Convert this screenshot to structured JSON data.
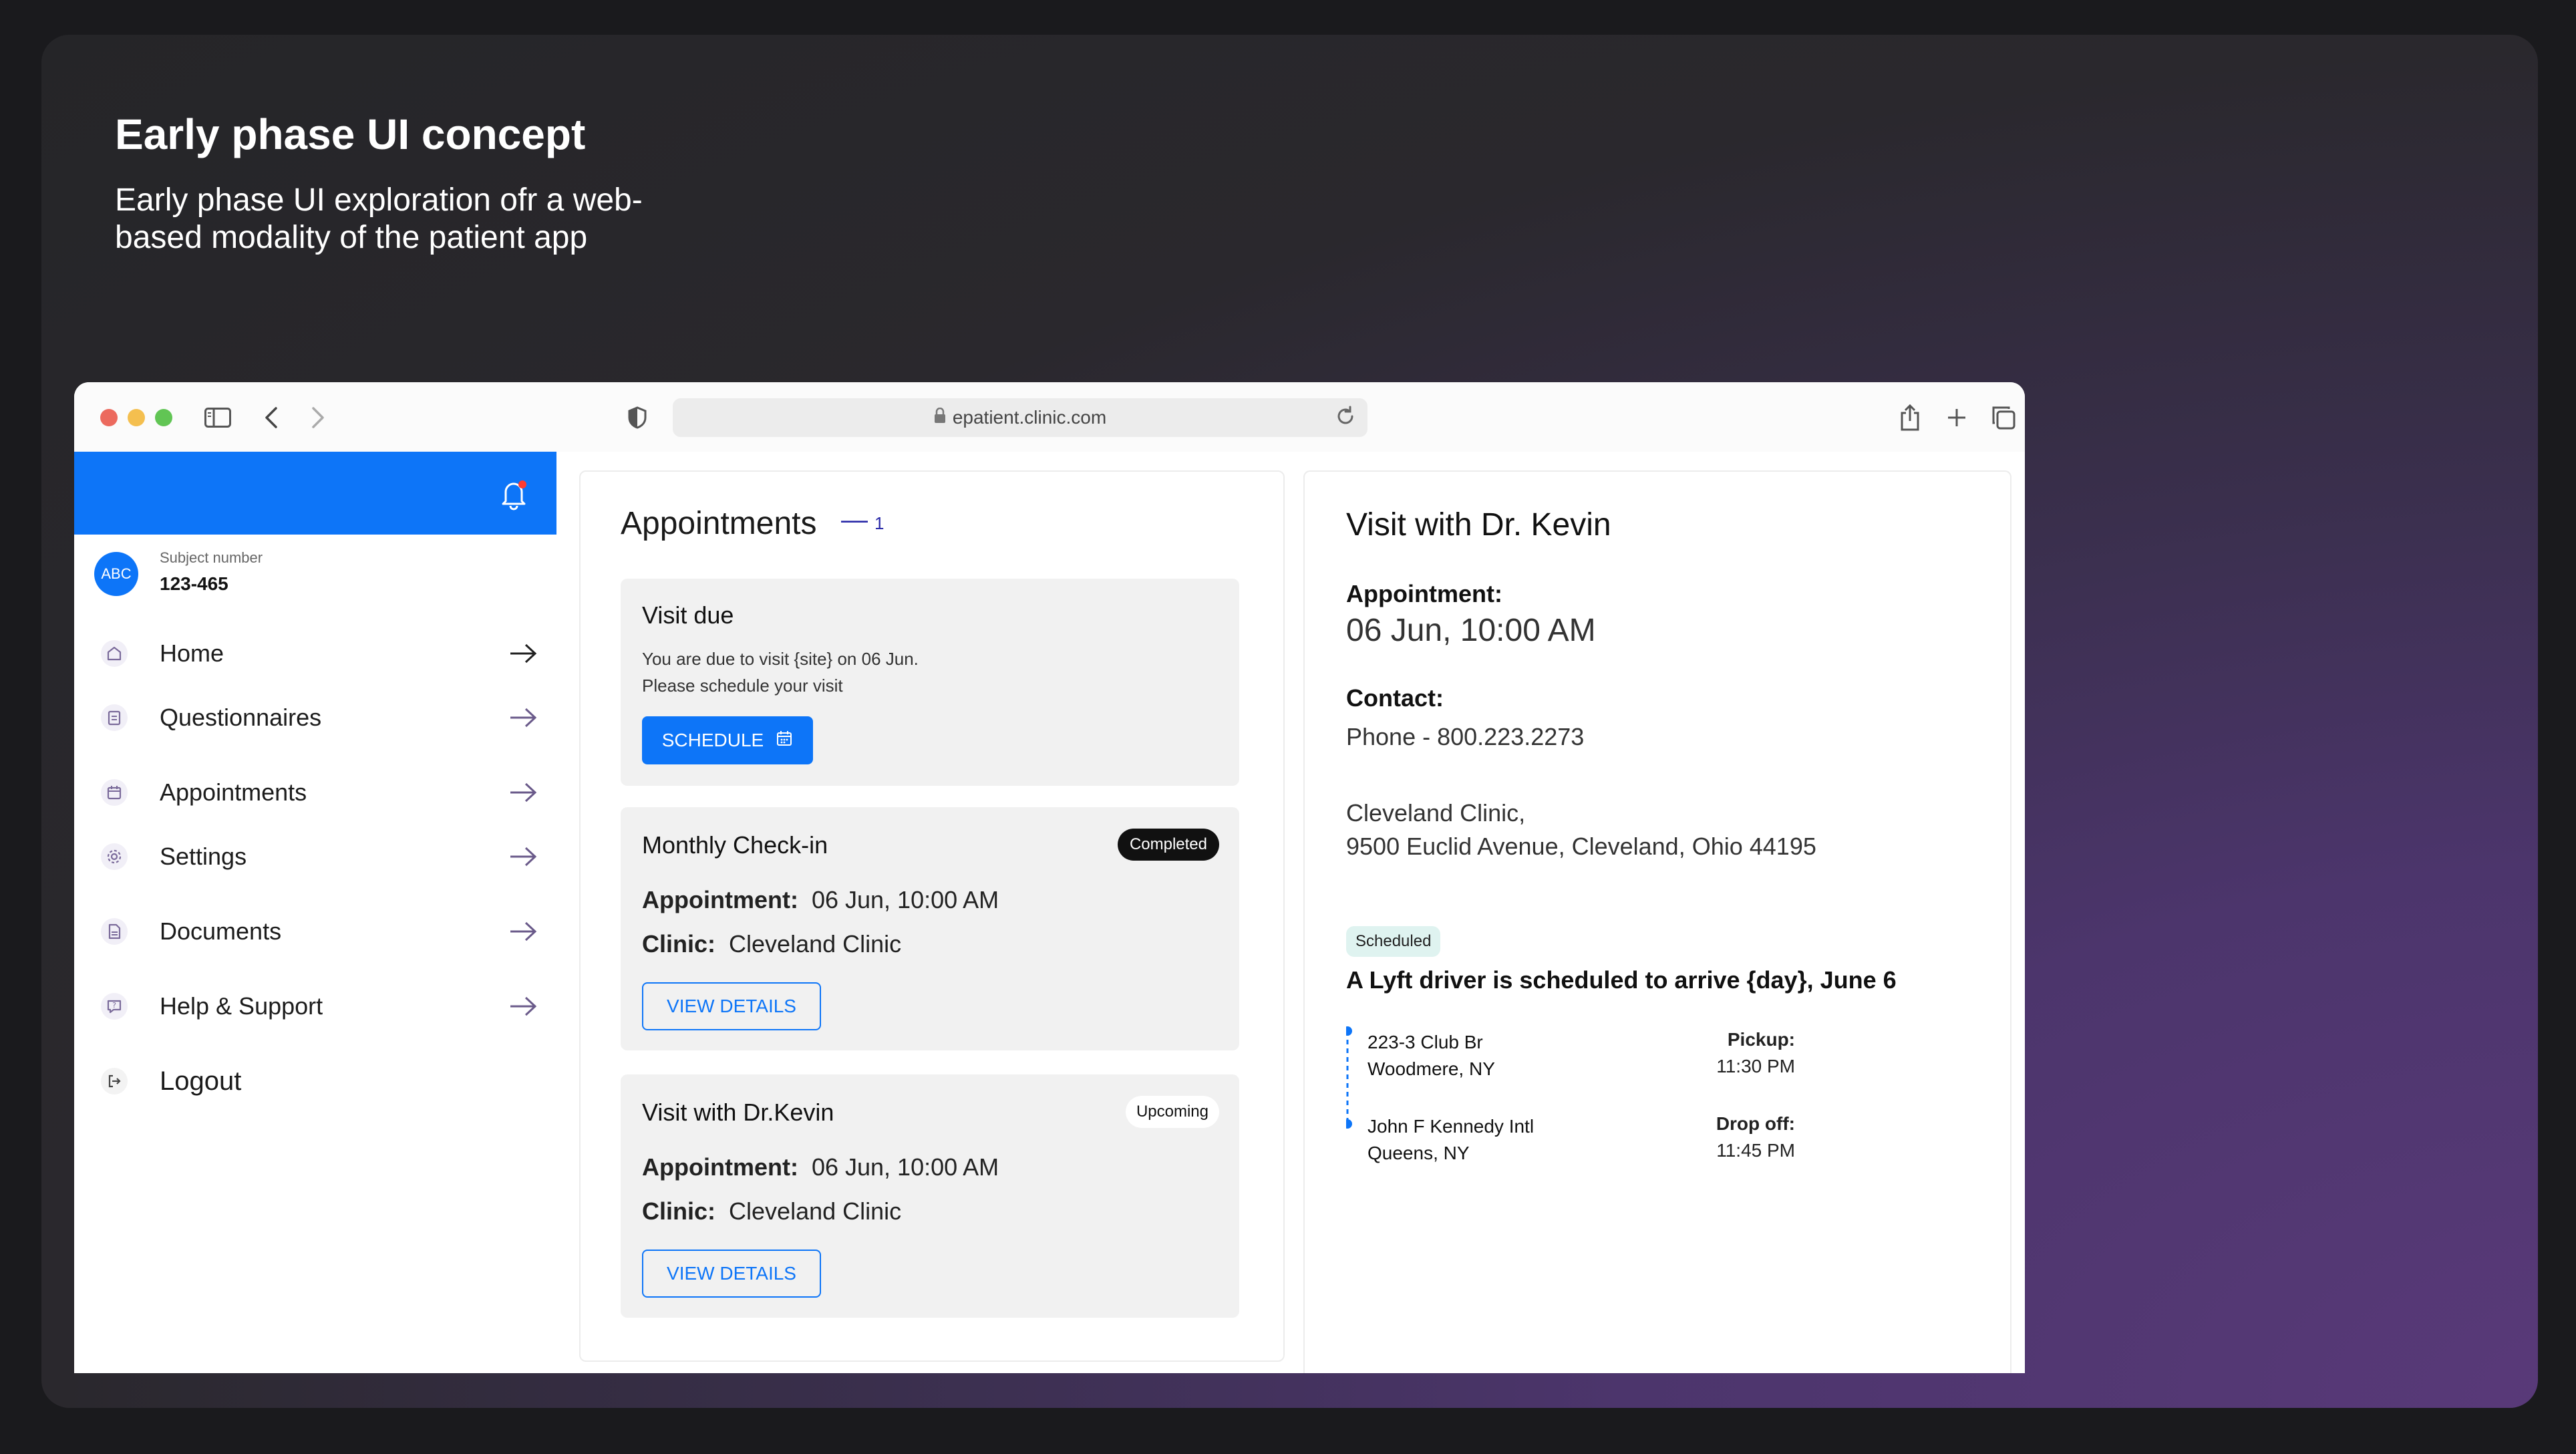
{
  "hero": {
    "title": "Early phase UI concept",
    "subtitle": "Early phase UI exploration ofr a web-based modality of the patient app"
  },
  "browser": {
    "url": "epatient.clinic.com"
  },
  "sidebar": {
    "subject_label": "Subject number",
    "subject_number": "123-465",
    "avatar_text": "ABC",
    "items": [
      {
        "label": "Home",
        "icon": "home-icon"
      },
      {
        "label": "Questionnaires",
        "icon": "clipboard-icon"
      },
      {
        "label": "Appointments",
        "icon": "calendar-icon"
      },
      {
        "label": "Settings",
        "icon": "gear-icon"
      },
      {
        "label": "Documents",
        "icon": "document-icon"
      },
      {
        "label": "Help & Support",
        "icon": "help-chat-icon"
      },
      {
        "label": "Logout",
        "icon": "logout-icon"
      }
    ]
  },
  "appointments": {
    "title": "Appointments",
    "dash": "—",
    "count": "1",
    "visit_due": {
      "title": "Visit due",
      "line1": "You are due to visit {site} on 06 Jun.",
      "line2": "Please schedule your visit",
      "button": "SCHEDULE"
    },
    "cards": [
      {
        "title": "Monthly Check-in",
        "badge": "Completed",
        "appt_label": "Appointment:",
        "appt_value": "06 Jun, 10:00 AM",
        "clinic_label": "Clinic:",
        "clinic_value": "Cleveland Clinic",
        "button": "VIEW DETAILS"
      },
      {
        "title": "Visit with Dr.Kevin",
        "badge": "Upcoming",
        "appt_label": "Appointment:",
        "appt_value": "06 Jun, 10:00 AM",
        "clinic_label": "Clinic:",
        "clinic_value": "Cleveland Clinic",
        "button": "VIEW DETAILS"
      }
    ]
  },
  "visit": {
    "title": "Visit with Dr. Kevin",
    "appt_label": "Appointment:",
    "appt_value": "06 Jun, 10:00 AM",
    "contact_label": "Contact:",
    "phone": "Phone - 800.223.2273",
    "address_line1": "Cleveland Clinic,",
    "address_line2": "9500 Euclid Avenue, Cleveland, Ohio 44195",
    "status_badge": "Scheduled",
    "lyft_text": "A Lyft driver is scheduled to arrive {day}, June 6",
    "pickup": {
      "line1": "223-3 Club Br",
      "line2": "Woodmere, NY",
      "label": "Pickup:",
      "time": "11:30 PM"
    },
    "dropoff": {
      "line1": "John F Kennedy Intl",
      "line2": "Queens, NY",
      "label": "Drop off:",
      "time": "11:45 PM"
    }
  },
  "colors": {
    "primary": "#0d75f8",
    "badge_dark": "#111111",
    "scheduled_badge": "#dff3f0",
    "card_bg": "#f1f1f1"
  }
}
